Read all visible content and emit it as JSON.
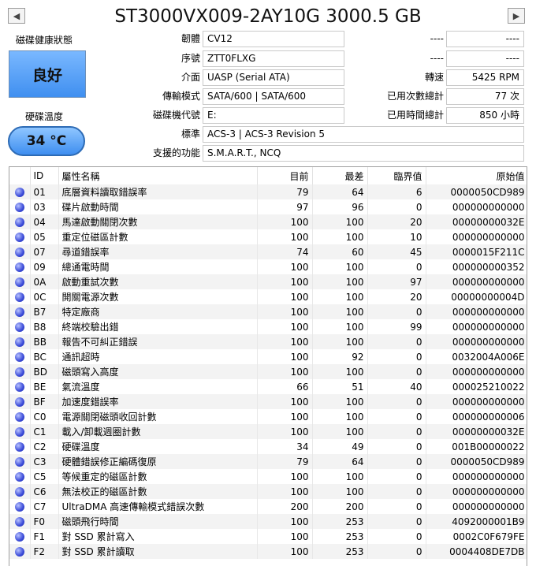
{
  "header": {
    "title": "ST3000VX009-2AY10G 3000.5 GB",
    "prev_symbol": "◀",
    "next_symbol": "▶"
  },
  "status": {
    "health_label": "磁碟健康狀態",
    "health_value": "良好",
    "temp_label": "硬碟溫度",
    "temp_value": "34 °C"
  },
  "info": {
    "firmware_label": "韌體",
    "firmware": "CV12",
    "serial_label": "序號",
    "serial": "ZTT0FLXG",
    "interface_label": "介面",
    "interface": "UASP (Serial ATA)",
    "transfer_label": "傳輸模式",
    "transfer": "SATA/600 | SATA/600",
    "drive_letter_label": "磁碟機代號",
    "drive_letter": "E:",
    "standard_label": "標準",
    "standard": "ACS-3 | ACS-3 Revision 5",
    "features_label": "支援的功能",
    "features": "S.M.A.R.T., NCQ",
    "right1_label": "----",
    "right1_value": "----",
    "right2_label": "----",
    "right2_value": "----",
    "rpm_label": "轉速",
    "rpm": "5425 RPM",
    "power_count_label": "已用次數總計",
    "power_count": "77 次",
    "power_hours_label": "已用時間總計",
    "power_hours": "850 小時"
  },
  "colors": {
    "health": "#4f9cf5",
    "status_dot": "#3a4ad8"
  },
  "table": {
    "columns": [
      "",
      "ID",
      "屬性名稱",
      "目前",
      "最差",
      "臨界值",
      "原始值"
    ],
    "rows": [
      [
        "01",
        "底層資料讀取錯誤率",
        "79",
        "64",
        "6",
        "0000050CD989"
      ],
      [
        "03",
        "碟片啟動時間",
        "97",
        "96",
        "0",
        "000000000000"
      ],
      [
        "04",
        "馬達啟動關閉次數",
        "100",
        "100",
        "20",
        "00000000032E"
      ],
      [
        "05",
        "重定位磁區計數",
        "100",
        "100",
        "10",
        "000000000000"
      ],
      [
        "07",
        "尋道錯誤率",
        "74",
        "60",
        "45",
        "0000015F211C"
      ],
      [
        "09",
        "總通電時間",
        "100",
        "100",
        "0",
        "000000000352"
      ],
      [
        "0A",
        "啟動重試次數",
        "100",
        "100",
        "97",
        "000000000000"
      ],
      [
        "0C",
        "開關電源次數",
        "100",
        "100",
        "20",
        "00000000004D"
      ],
      [
        "B7",
        "特定廠商",
        "100",
        "100",
        "0",
        "000000000000"
      ],
      [
        "B8",
        "終端校驗出錯",
        "100",
        "100",
        "99",
        "000000000000"
      ],
      [
        "BB",
        "報告不可糾正錯誤",
        "100",
        "100",
        "0",
        "000000000000"
      ],
      [
        "BC",
        "通訊超時",
        "100",
        "92",
        "0",
        "0032004A006E"
      ],
      [
        "BD",
        "磁頭寫入高度",
        "100",
        "100",
        "0",
        "000000000000"
      ],
      [
        "BE",
        "氣流溫度",
        "66",
        "51",
        "40",
        "000025210022"
      ],
      [
        "BF",
        "加速度錯誤率",
        "100",
        "100",
        "0",
        "000000000000"
      ],
      [
        "C0",
        "電源關閉磁頭收回計數",
        "100",
        "100",
        "0",
        "000000000006"
      ],
      [
        "C1",
        "載入/卸載週圈計數",
        "100",
        "100",
        "0",
        "00000000032E"
      ],
      [
        "C2",
        "硬碟溫度",
        "34",
        "49",
        "0",
        "001B00000022"
      ],
      [
        "C3",
        "硬體錯誤修正編碼復原",
        "79",
        "64",
        "0",
        "0000050CD989"
      ],
      [
        "C5",
        "等候重定的磁區計數",
        "100",
        "100",
        "0",
        "000000000000"
      ],
      [
        "C6",
        "無法校正的磁區計數",
        "100",
        "100",
        "0",
        "000000000000"
      ],
      [
        "C7",
        "UltraDMA 高速傳輸模式錯誤次數",
        "200",
        "200",
        "0",
        "000000000000"
      ],
      [
        "F0",
        "磁頭飛行時間",
        "100",
        "253",
        "0",
        "4092000001B9"
      ],
      [
        "F1",
        "對 SSD 累計寫入",
        "100",
        "253",
        "0",
        "0002C0F679FE"
      ],
      [
        "F2",
        "對 SSD 累計讀取",
        "100",
        "253",
        "0",
        "0004408DE7DB"
      ]
    ]
  }
}
